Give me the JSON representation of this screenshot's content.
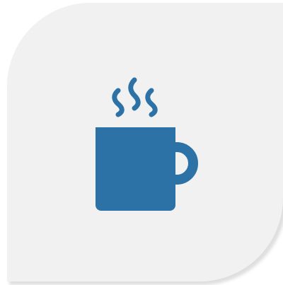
{
  "tile": {
    "background_color": "#f1f1f1",
    "shadow_color": "#d9d9d9"
  },
  "icon": {
    "name": "coffee-mug-icon",
    "color": "#2d72a6"
  }
}
